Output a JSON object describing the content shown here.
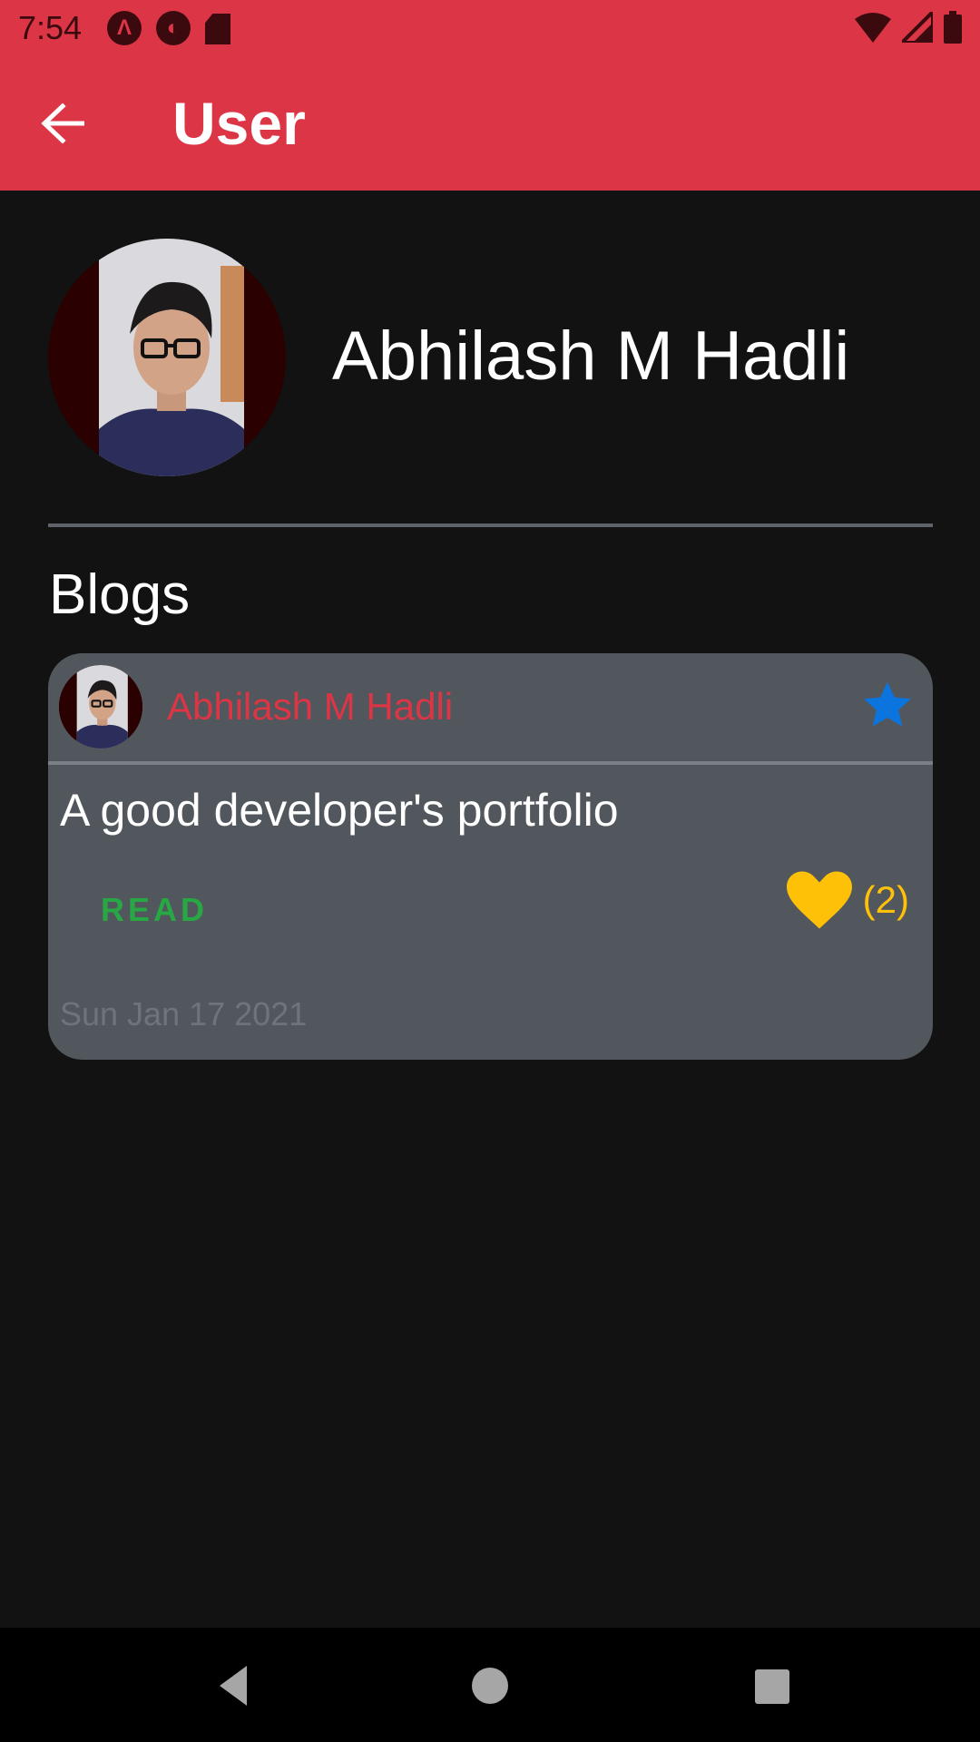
{
  "status_bar": {
    "time": "7:54",
    "left_icons": [
      "angular-icon",
      "notification-icon",
      "sd-card-icon"
    ],
    "right_icons": [
      "wifi-icon",
      "signal-icon",
      "battery-icon"
    ]
  },
  "app_bar": {
    "title": "User",
    "back_icon": "arrow-left-icon"
  },
  "profile": {
    "name": "Abhilash M Hadli"
  },
  "blogs_section": {
    "title": "Blogs",
    "cards": [
      {
        "author": "Abhilash M Hadli",
        "title": "A good developer's portfolio",
        "action_label": "READ",
        "likes": "(2)",
        "date": "Sun Jan 17 2021",
        "starred": true
      }
    ]
  },
  "colors": {
    "primary": "#dc3545",
    "background": "#121212",
    "card": "#52575d",
    "star": "#0b74de",
    "heart": "#ffc107",
    "read": "#28a745"
  },
  "nav_bar": {
    "icons": [
      "nav-back-icon",
      "nav-home-icon",
      "nav-recents-icon"
    ]
  }
}
